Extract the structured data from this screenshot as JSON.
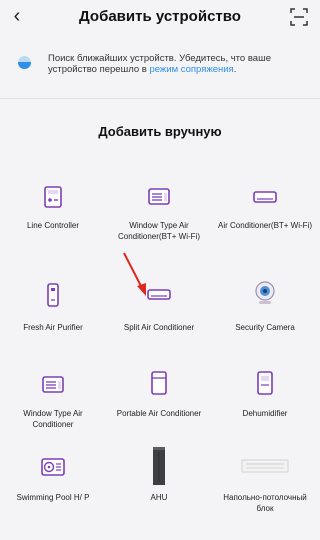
{
  "header": {
    "back_icon": "chevron-left-icon",
    "title": "Добавить устройство",
    "scan_icon": "scan-icon"
  },
  "banner": {
    "text": "Поиск ближайших устройств. Убедитесь, что ваше устройство перешло в ",
    "link": "режим сопряжения",
    "suffix": "."
  },
  "section_title": "Добавить вручную",
  "devices": [
    {
      "label": "Line Controller",
      "icon": "line-controller-icon"
    },
    {
      "label": "Window Type Air Conditioner(BT+ Wi-Fi)",
      "icon": "window-ac-icon"
    },
    {
      "label": "Air Conditioner(BT+ Wi-Fi)",
      "icon": "air-conditioner-icon"
    },
    {
      "label": "Fresh Air Purifier",
      "icon": "fresh-air-purifier-icon"
    },
    {
      "label": "Split Air Conditioner",
      "icon": "split-ac-icon"
    },
    {
      "label": "Security Camera",
      "icon": "security-camera-icon"
    },
    {
      "label": "Window Type Air Conditioner",
      "icon": "window-ac-icon"
    },
    {
      "label": "Portable Air Conditioner",
      "icon": "portable-ac-icon"
    },
    {
      "label": "Dehumidifier",
      "icon": "dehumidifier-icon"
    },
    {
      "label": "Swimming Pool H/ P",
      "icon": "pool-heat-pump-icon"
    },
    {
      "label": "AHU",
      "icon": "ahu-icon"
    },
    {
      "label": "Напольно-потолочный блок",
      "icon": "floor-ceiling-unit-icon"
    }
  ],
  "colors": {
    "accent": "#7b3fb6",
    "link": "#2e8ee8",
    "arrow": "#e0261f"
  }
}
